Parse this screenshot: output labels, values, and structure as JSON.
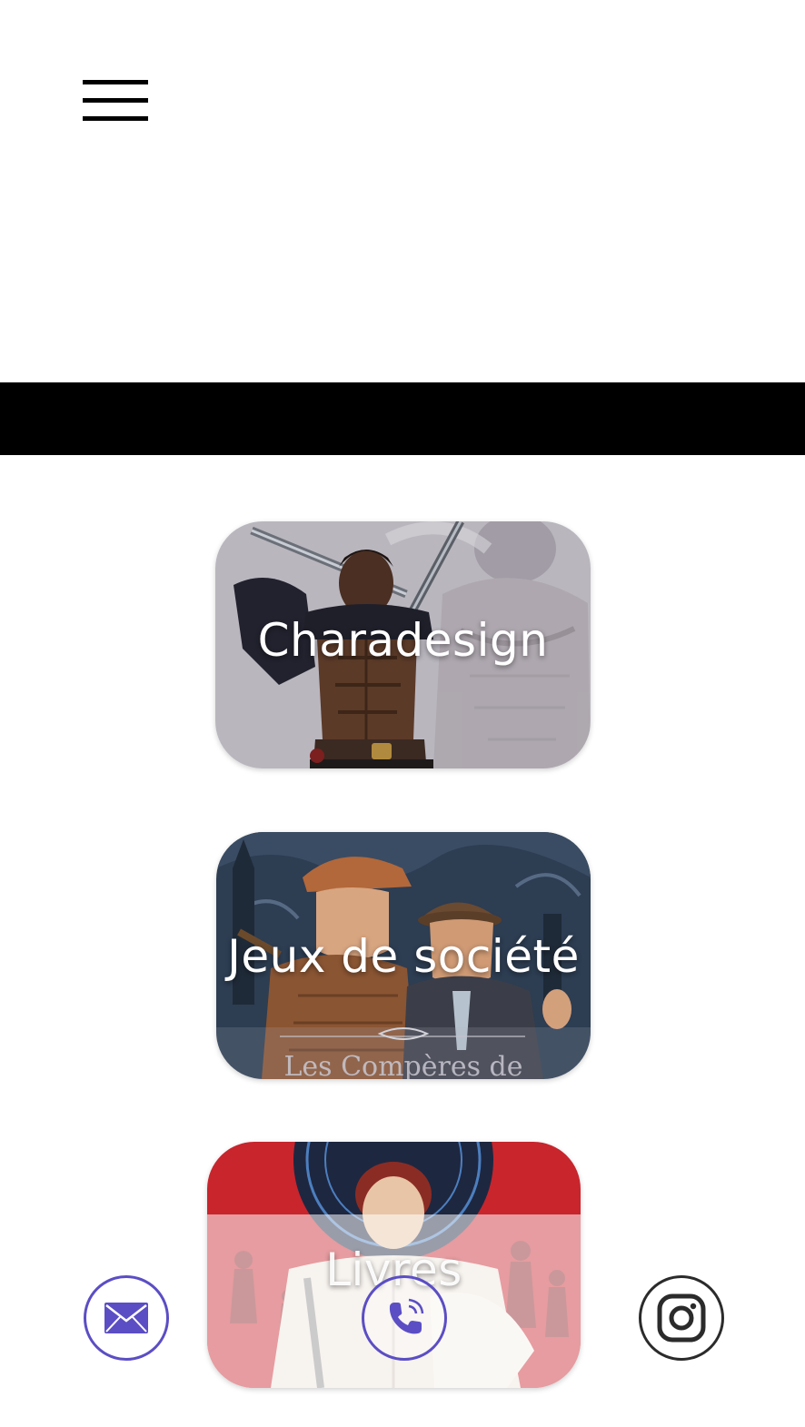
{
  "header": {
    "menu_icon": "hamburger-menu-icon"
  },
  "cards": [
    {
      "label": "Charadesign"
    },
    {
      "label": "Jeux de société",
      "cover_text": "Les Compères de"
    },
    {
      "label": "Livres"
    }
  ],
  "social": {
    "mail_icon": "envelope-icon",
    "phone_icon": "phone-icon",
    "instagram_icon": "instagram-icon"
  },
  "colors": {
    "band": "#000000",
    "icon_accent": "#5b4ec4",
    "instagram_stroke": "#2b2b2b"
  }
}
